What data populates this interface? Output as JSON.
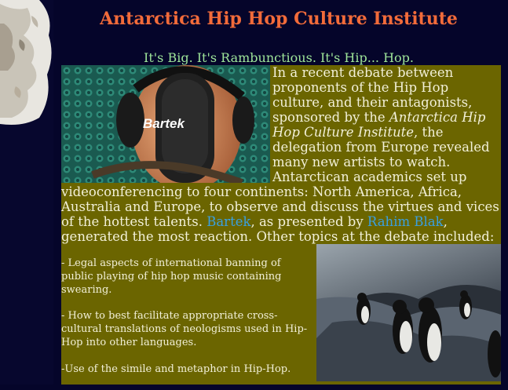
{
  "page": {
    "title": "Antarctica Hip Hop Culture Institute",
    "tagline": "It's Big. It's Rambunctious. It's Hip... Hop."
  },
  "photo_bartek": {
    "caption": "Bartek"
  },
  "article": {
    "intro": "In a recent debate between proponents of the  Hip Hop culture, and their antagonists, sponsored by the ",
    "institute_italic": "Antarctica Hip Hop Culture Institute",
    "middle": ", the delegation from Europe revealed many new artists to watch. Antarctican academics set up videoconferencing to four continents: North America, Africa, Australia and Europe, to observe and discuss the virtues and vices of the hottest talents. ",
    "link_bartek": "Bartek",
    "presented_by": ", as presented by ",
    "link_rahim": "Rahim Blak",
    "ending": ", generated the most reaction. Other topics at the debate included:"
  },
  "topics": [
    "- Legal aspects of international banning of public playing of hip hop music containing swearing.",
    "- How to best facilitate appropriate cross-cultural translations of neologisms used in Hip-Hop into other languages.",
    "-Use of the simile and metaphor in Hip-Hop."
  ],
  "colors": {
    "background": "#05052a",
    "title": "#f26b3a",
    "tagline": "#9fe69a",
    "content_bg": "#6b6500",
    "link": "#3aa0e0"
  }
}
